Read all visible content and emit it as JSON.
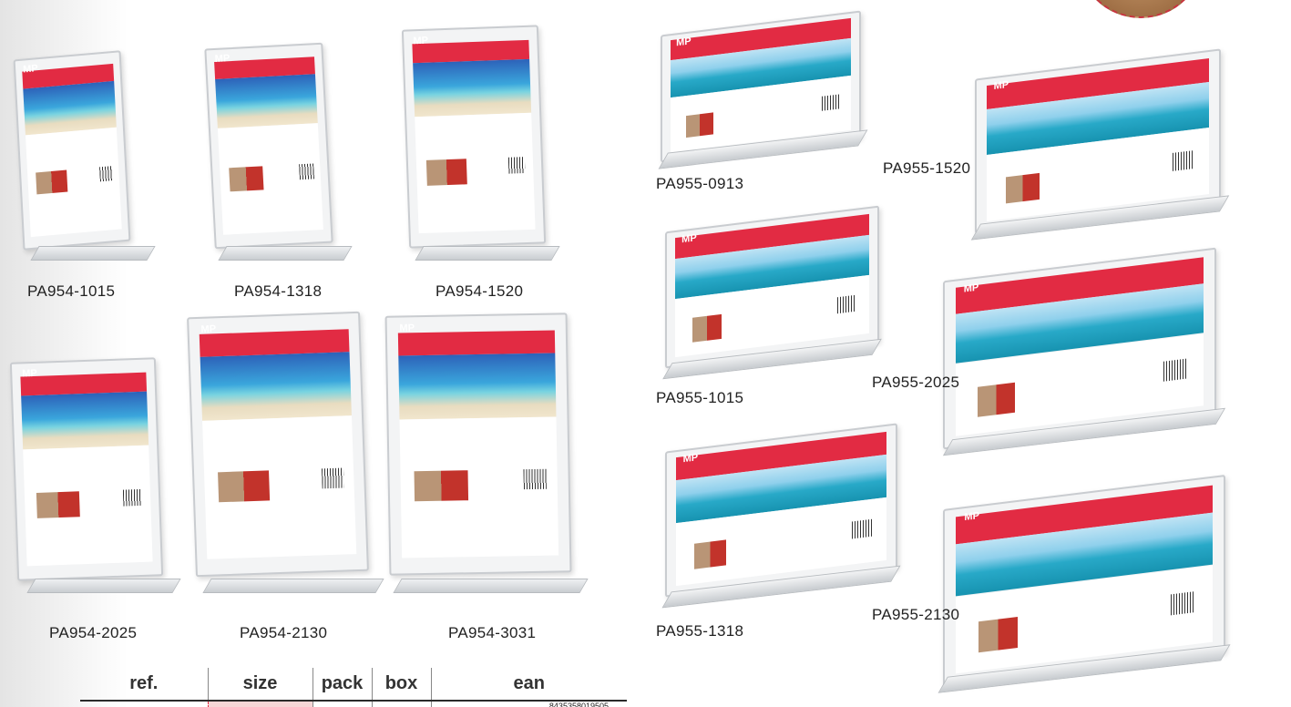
{
  "products": {
    "pa954_1015": "PA954-1015",
    "pa954_1318": "PA954-1318",
    "pa954_1520": "PA954-1520",
    "pa954_2025": "PA954-2025",
    "pa954_2130": "PA954-2130",
    "pa954_3031": "PA954-3031",
    "pa955_0913": "PA955-0913",
    "pa955_1015": "PA955-1015",
    "pa955_1318": "PA955-1318",
    "pa955_1520": "PA955-1520",
    "pa955_2025": "PA955-2025",
    "pa955_2130": "PA955-2130"
  },
  "brand": {
    "logo": "MP"
  },
  "table": {
    "headers": [
      "ref.",
      "size",
      "pack",
      "box",
      "ean"
    ],
    "first_row_ean": "8435358019505"
  },
  "colors": {
    "accent_red": "#e22b43",
    "text": "#222222"
  }
}
